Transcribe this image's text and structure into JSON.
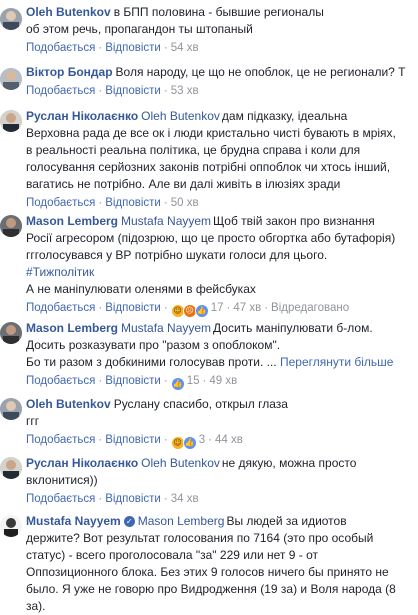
{
  "comments": [
    {
      "author": "Oleh Butenkov",
      "mention": "",
      "line1": "в БПП половина - бывшие регионалы",
      "more": "об этом речь, пропагандон ты штопаный",
      "like": "Подобається",
      "reply": "Відповісти",
      "reaction_count": "",
      "time": "54 хв",
      "edited": ""
    },
    {
      "author": "Віктор Бондар",
      "line1": "Воля народу, це що не опоблок, це не регионали? Т",
      "like": "Подобається",
      "reply": "Відповісти",
      "time": "53 хв"
    },
    {
      "author": "Руслан Ніколаєнко",
      "mention": "Oleh Butenkov",
      "line1": "дам підказку, ідеальна",
      "more": "Верховна рада де все ок і люди кристально чисті бувають в мріях, в реальності реальна політика, це брудна справа і коли для голосування серйозних законів потрібні оппоблок чи хтось інший, вагатись не потрібно. Але ви далі живіть в ілюзіях зради",
      "like": "Подобається",
      "reply": "Відповісти",
      "time": "50 хв"
    },
    {
      "author": "Mason Lemberg",
      "mention": "Mustafa Nayyem",
      "line1": "Щоб твій закон про визнання",
      "more": "Росії агресором (підозрюю, що це просто обгортка або бутафорія) ггголосувався у ВР потрібно шукати голоси для цього.",
      "hashtag": "#Тижполітик",
      "extra": "А не маніпулювати оленями в фейсбуках",
      "like": "Подобається",
      "reply": "Відповісти",
      "reaction_count": "17",
      "time": "47 хв",
      "edited": "Відредаговано"
    },
    {
      "author": "Mason Lemberg",
      "mention": "Mustafa Nayyem",
      "line1": "Досить маніпулювати б-лом.",
      "more": "Досить розказувати про \"разом з опоблоком\".",
      "extra": "Бо ти разом з добкиними голосував проти. ...",
      "see_more": "Переглянути більше",
      "like": "Подобається",
      "reply": "Відповісти",
      "reaction_count": "15",
      "time": "49 хв"
    },
    {
      "author": "Oleh Butenkov",
      "line1": "Руслану спасибо, открыл глаза",
      "more": "ггг",
      "like": "Подобається",
      "reply": "Відповісти",
      "reaction_count": "3",
      "time": "44 хв"
    },
    {
      "author": "Руслан Ніколаєнко",
      "mention": "Oleh Butenkov",
      "line1": "не дякую, можна просто",
      "more": "вклонитися))",
      "like": "Подобається",
      "reply": "Відповісти",
      "time": "34 хв"
    },
    {
      "author": "Mustafa Nayyem",
      "mention": "Mason Lemberg",
      "line1": "Вы людей за идиотов",
      "more": "держите? Вот результат голосования по 7164 (это про особый статус) - всего проголосовала \"за\" 229 или нет 9 - от Оппозиционного блока. Без этих 9 голосов ничего бы принято не было. Я уже не говорю про Видродження (19 за) и Воля народа (8 за)."
    }
  ],
  "colors": {
    "link": "#365899",
    "action": "#4267b2",
    "muted": "#90949c",
    "text": "#1d2129"
  },
  "icons": {
    "like": "like-emoji-icon",
    "haha": "haha-emoji-icon",
    "angry": "angry-emoji-icon",
    "verified": "verified-badge-icon"
  }
}
